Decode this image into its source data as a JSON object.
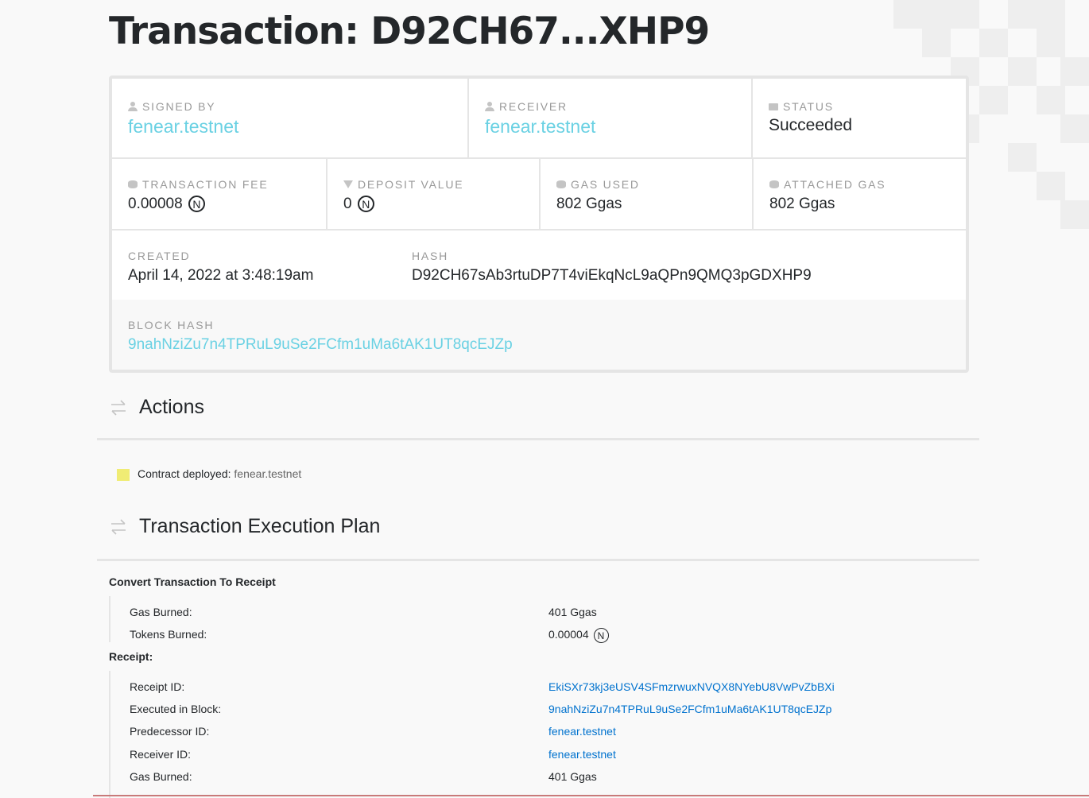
{
  "page": {
    "title": "Transaction: D92CH67...XHP9"
  },
  "info": {
    "signed_by": {
      "label": "SIGNED BY",
      "value": "fenear.testnet"
    },
    "receiver": {
      "label": "RECEIVER",
      "value": "fenear.testnet"
    },
    "status": {
      "label": "STATUS",
      "value": "Succeeded"
    },
    "transaction_fee": {
      "label": "TRANSACTION FEE",
      "value": "0.00008"
    },
    "deposit_value": {
      "label": "DEPOSIT VALUE",
      "value": "0"
    },
    "gas_used": {
      "label": "GAS USED",
      "value": "802 Ggas"
    },
    "attached_gas": {
      "label": "ATTACHED GAS",
      "value": "802 Ggas"
    },
    "created": {
      "label": "CREATED",
      "value": "April 14, 2022 at 3:48:19am"
    },
    "hash": {
      "label": "HASH",
      "value": "D92CH67sAb3rtuDP7T4viEkqNcL9aQPn9QMQ3pGDXHP9"
    },
    "block_hash": {
      "label": "BLOCK HASH",
      "value": "9nahNziZu7n4TPRuL9uSe2FCfm1uMa6tAK1UT8qcEJZp"
    },
    "near_symbol": "N"
  },
  "actions": {
    "heading": "Actions",
    "items": [
      {
        "label": "Contract deployed:",
        "value": "fenear.testnet"
      }
    ]
  },
  "plan": {
    "heading": "Transaction Execution Plan",
    "convert_title": "Convert Transaction To Receipt",
    "convert_rows": [
      {
        "key": "Gas Burned:",
        "value": "401 Ggas"
      },
      {
        "key": "Tokens Burned:",
        "value": "0.00004"
      }
    ],
    "receipt_title": "Receipt:",
    "receipt_rows": [
      {
        "key": "Receipt ID:",
        "value": "EkiSXr73kj3eUSV4SFmzrwuxNVQX8NYebU8VwPvZbBXi"
      },
      {
        "key": "Executed in Block:",
        "value": "9nahNziZu7n4TPRuL9uSe2FCfm1uMa6tAK1UT8qcEJZp"
      },
      {
        "key": "Predecessor ID:",
        "value": "fenear.testnet"
      },
      {
        "key": "Receiver ID:",
        "value": "fenear.testnet"
      },
      {
        "key": "Gas Burned:",
        "value": "401 Ggas"
      }
    ]
  },
  "colors": {
    "link": "#6ad1e3",
    "plan_link": "#0072ce",
    "note_yellow": "#f0ec74"
  }
}
